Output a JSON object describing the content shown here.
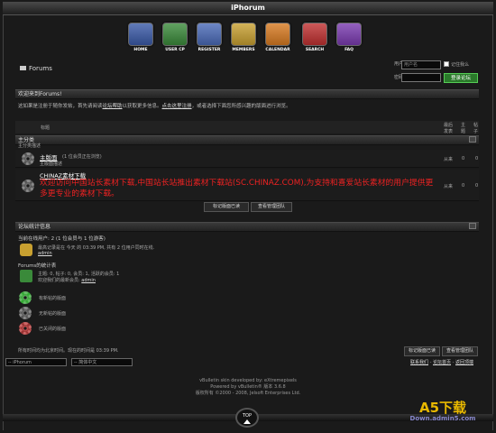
{
  "app_title": "iPhorum",
  "nav": [
    {
      "label": "HOME",
      "color": "#3a5aa8",
      "icon": "home-icon"
    },
    {
      "label": "USER CP",
      "color": "#3a8a3a",
      "icon": "user-cp-icon"
    },
    {
      "label": "REGISTER",
      "color": "#4a6ab8",
      "icon": "register-icon"
    },
    {
      "label": "MEMBERS",
      "color": "#c8a030",
      "icon": "members-icon"
    },
    {
      "label": "CALENDAR",
      "color": "#d87a20",
      "icon": "calendar-icon"
    },
    {
      "label": "SEARCH",
      "color": "#c03030",
      "icon": "search-icon"
    },
    {
      "label": "FAQ",
      "color": "#7a3ab0",
      "icon": "faq-icon"
    }
  ],
  "header": {
    "forum_label": "Forums"
  },
  "login": {
    "username_label": "用户名",
    "password_label": "密码",
    "username_placeholder": "用户名",
    "remember_label": "记住我么",
    "login_button": "登录论坛"
  },
  "welcome": {
    "title": "欢迎来到Forums!",
    "text_a": "这如果是注册于随你发帖，首先请阅读",
    "link_faq": "论坛帮助",
    "text_b": "以获取更多信息。",
    "link_register": "点击这里注册",
    "text_c": "，或者选择下面您所感兴趣的版面进行浏览。"
  },
  "forum_table": {
    "col_title": "标题",
    "col_last": "最后发表",
    "col_topics": "主题",
    "col_posts": "帖子"
  },
  "category": {
    "name": "主分类",
    "desc": "主分类描述"
  },
  "forums": [
    {
      "title": "主版面",
      "meta": "(1 位会员正在浏览)",
      "desc": "主版面描述",
      "last": "从来",
      "topics": "0",
      "posts": "0"
    },
    {
      "title": "CHINAZ素材下载",
      "meta": "",
      "desc": "",
      "last": "从来",
      "topics": "0",
      "posts": "0"
    }
  ],
  "red_notice": "欢迎访问中国站长素材下载,中国站长站推出素材下载站(SC.CHINAZ.COM),为支持和喜爱站长素材的用户提供更多更专业的素材下载。",
  "forum_actions": {
    "mark_read": "标记版面已读",
    "view_staff": "查看管理团队"
  },
  "stats": {
    "title": "论坛统计信息",
    "online_title": "当前在线用户: 2 (1 位会员与 1 位游客)",
    "online_text": "最高记录是在 今天 的 03:39 PM, 共有 2 位用户同时在线.",
    "online_user": "admin",
    "stats_title": "Forums的统计表",
    "stats_text": "主题: 0, 帖子: 0, 会员: 1, 活跃的会员: 1",
    "newest_label": "欢迎我们的最新会员:",
    "newest_user": "admin"
  },
  "legend": [
    {
      "label": "有新帖的版面",
      "type": "green"
    },
    {
      "label": "无新帖的版面",
      "type": "gray"
    },
    {
      "label": "已关闭的版面",
      "type": "red"
    }
  ],
  "footer": {
    "timezone": "所有时间均为北京时间。现在的时间是 03:39 PM.",
    "mark_read": "标记版面已读",
    "view_staff": "查看管理团队",
    "style_select": "-- iPhorum",
    "lang_select": "-- 简体中文",
    "link_contact": "联系我们",
    "link_home": "论坛首页",
    "link_top": "返回顶端",
    "credit1": "vBulletin skin developed by: eXtremepixels",
    "credit2": "Powered by vBulletin® 版本 3.6.8",
    "credit3": "版权所有 ©2000 - 2008, Jelsoft Enterprises Ltd.",
    "top_label": "TOP",
    "watermark_main": "A5下载",
    "watermark_sub": "Down.admin5.com"
  }
}
